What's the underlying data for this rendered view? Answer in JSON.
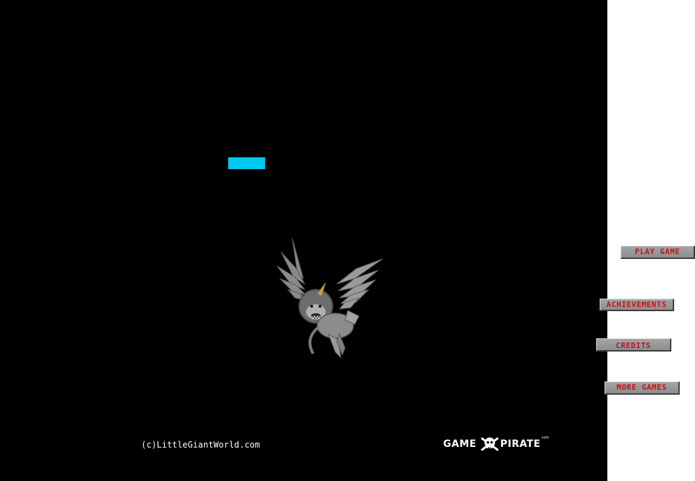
{
  "game": {
    "copyright": "(c)LittleGiantWorld.com",
    "sponsor_logo": {
      "left_word": "GAME",
      "right_word": "PIRATE",
      "suffix": ".com",
      "icon": "skull-crossbones-icon"
    },
    "accent_color": "#00c8f0",
    "creature": "winged-lion-sprite"
  },
  "menu": {
    "play_label": "PLAY GAME",
    "achievements_label": "ACHIEVEMENTS",
    "credits_label": "CREDITS",
    "more_games_label": "MORE GAMES",
    "label_color": "#c8101a"
  }
}
